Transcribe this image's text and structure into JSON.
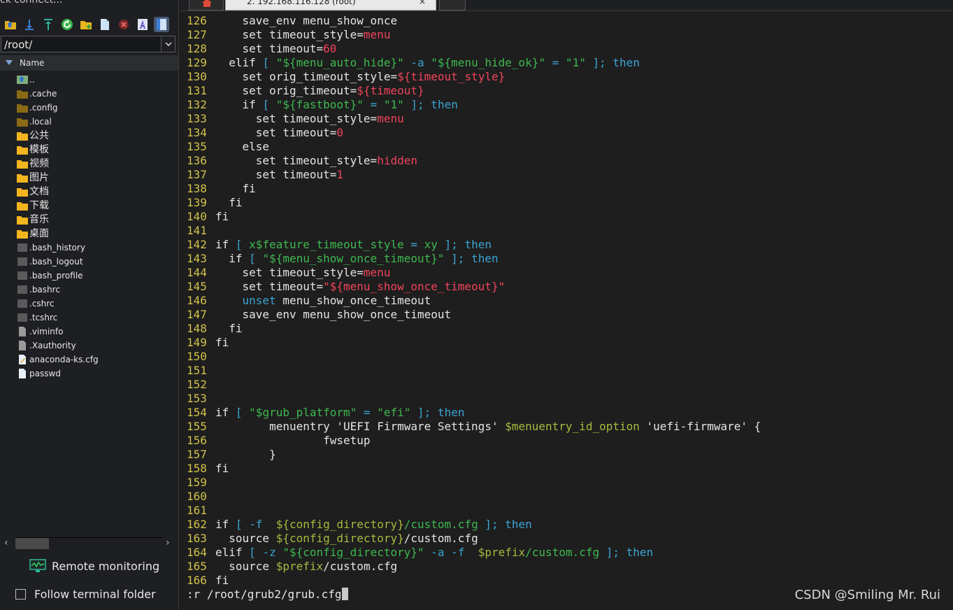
{
  "left_panel": {
    "quick_connect_text": "ck connect...",
    "path": "/root/",
    "column_header": "Name",
    "files": [
      {
        "name": "..",
        "type": "parent"
      },
      {
        "name": ".cache",
        "type": "folder-dark"
      },
      {
        "name": ".config",
        "type": "folder-dark"
      },
      {
        "name": ".local",
        "type": "folder-dark"
      },
      {
        "name": "公共",
        "type": "folder"
      },
      {
        "name": "模板",
        "type": "folder"
      },
      {
        "name": "视频",
        "type": "folder"
      },
      {
        "name": "图片",
        "type": "folder"
      },
      {
        "name": "文档",
        "type": "folder"
      },
      {
        "name": "下载",
        "type": "folder"
      },
      {
        "name": "音乐",
        "type": "folder"
      },
      {
        "name": "桌面",
        "type": "folder"
      },
      {
        "name": ".bash_history",
        "type": "file-dark"
      },
      {
        "name": ".bash_logout",
        "type": "file-dark"
      },
      {
        "name": ".bash_profile",
        "type": "file-dark"
      },
      {
        "name": ".bashrc",
        "type": "file-dark"
      },
      {
        "name": ".cshrc",
        "type": "file-dark"
      },
      {
        "name": ".tcshrc",
        "type": "file-dark"
      },
      {
        "name": ".viminfo",
        "type": "file-gray"
      },
      {
        "name": ".Xauthority",
        "type": "file-gray"
      },
      {
        "name": "anaconda-ks.cfg",
        "type": "file-cfg"
      },
      {
        "name": "passwd",
        "type": "file-white"
      }
    ],
    "remote_monitoring": "Remote monitoring",
    "follow_terminal_folder": "Follow terminal folder"
  },
  "tabs": {
    "session_title": "2. 192.168.116.128 (root)",
    "close_glyph": "×"
  },
  "terminal": {
    "lines": [
      {
        "n": "126",
        "t": [
          [
            "d",
            "    save_env menu_show_once"
          ]
        ]
      },
      {
        "n": "127",
        "t": [
          [
            "d",
            "    set timeout_style="
          ],
          [
            "v",
            "menu"
          ]
        ]
      },
      {
        "n": "128",
        "t": [
          [
            "d",
            "    set timeout="
          ],
          [
            "n",
            "60"
          ]
        ]
      },
      {
        "n": "129",
        "t": [
          [
            "d",
            "  elif "
          ],
          [
            "k",
            "[ "
          ],
          [
            "s",
            "\"${menu_auto_hide}\""
          ],
          [
            "d",
            " "
          ],
          [
            "k",
            "-a"
          ],
          [
            "d",
            " "
          ],
          [
            "s",
            "\"${menu_hide_ok}\""
          ],
          [
            "d",
            " "
          ],
          [
            "k",
            "="
          ],
          [
            "d",
            " "
          ],
          [
            "s",
            "\"1\""
          ],
          [
            "d",
            " "
          ],
          [
            "k",
            "]; then"
          ]
        ]
      },
      {
        "n": "130",
        "t": [
          [
            "d",
            "    set orig_timeout_style="
          ],
          [
            "v",
            "${timeout_style}"
          ]
        ]
      },
      {
        "n": "131",
        "t": [
          [
            "d",
            "    set orig_timeout="
          ],
          [
            "v",
            "${timeout}"
          ]
        ]
      },
      {
        "n": "132",
        "t": [
          [
            "d",
            "    if "
          ],
          [
            "k",
            "[ "
          ],
          [
            "s",
            "\"${fastboot}\""
          ],
          [
            "d",
            " "
          ],
          [
            "k",
            "="
          ],
          [
            "d",
            " "
          ],
          [
            "s",
            "\"1\""
          ],
          [
            "d",
            " "
          ],
          [
            "k",
            "]; then"
          ]
        ]
      },
      {
        "n": "133",
        "t": [
          [
            "d",
            "      set timeout_style="
          ],
          [
            "v",
            "menu"
          ]
        ]
      },
      {
        "n": "134",
        "t": [
          [
            "d",
            "      set timeout="
          ],
          [
            "n",
            "0"
          ]
        ]
      },
      {
        "n": "135",
        "t": [
          [
            "d",
            "    else"
          ]
        ]
      },
      {
        "n": "136",
        "t": [
          [
            "d",
            "      set timeout_style="
          ],
          [
            "v",
            "hidden"
          ]
        ]
      },
      {
        "n": "137",
        "t": [
          [
            "d",
            "      set timeout="
          ],
          [
            "n",
            "1"
          ]
        ]
      },
      {
        "n": "138",
        "t": [
          [
            "d",
            "    fi"
          ]
        ]
      },
      {
        "n": "139",
        "t": [
          [
            "d",
            "  fi"
          ]
        ]
      },
      {
        "n": "140",
        "t": [
          [
            "d",
            "fi"
          ]
        ]
      },
      {
        "n": "141",
        "t": []
      },
      {
        "n": "142",
        "t": [
          [
            "d",
            "if "
          ],
          [
            "k",
            "[ "
          ],
          [
            "s",
            "x$feature_timeout_style"
          ],
          [
            "d",
            " "
          ],
          [
            "k",
            "="
          ],
          [
            "d",
            " "
          ],
          [
            "s",
            "xy"
          ],
          [
            "d",
            " "
          ],
          [
            "k",
            "]; then"
          ]
        ]
      },
      {
        "n": "143",
        "t": [
          [
            "d",
            "  if "
          ],
          [
            "k",
            "[ "
          ],
          [
            "s",
            "\"${menu_show_once_timeout}\""
          ],
          [
            "d",
            " "
          ],
          [
            "k",
            "]; then"
          ]
        ]
      },
      {
        "n": "144",
        "t": [
          [
            "d",
            "    set timeout_style="
          ],
          [
            "v",
            "menu"
          ]
        ]
      },
      {
        "n": "145",
        "t": [
          [
            "d",
            "    set timeout="
          ],
          [
            "v",
            "\"${menu_show_once_timeout}\""
          ]
        ]
      },
      {
        "n": "146",
        "t": [
          [
            "d",
            "    "
          ],
          [
            "k",
            "unset"
          ],
          [
            "d",
            " menu_show_once_timeout"
          ]
        ]
      },
      {
        "n": "147",
        "t": [
          [
            "d",
            "    save_env menu_show_once_timeout"
          ]
        ]
      },
      {
        "n": "148",
        "t": [
          [
            "d",
            "  fi"
          ]
        ]
      },
      {
        "n": "149",
        "t": [
          [
            "d",
            "fi"
          ]
        ]
      },
      {
        "n": "150",
        "t": []
      },
      {
        "n": "151",
        "t": []
      },
      {
        "n": "152",
        "t": []
      },
      {
        "n": "153",
        "t": []
      },
      {
        "n": "154",
        "t": [
          [
            "d",
            "if "
          ],
          [
            "k",
            "[ "
          ],
          [
            "s",
            "\"$grub_platform\""
          ],
          [
            "d",
            " "
          ],
          [
            "k",
            "="
          ],
          [
            "d",
            " "
          ],
          [
            "s",
            "\"efi\""
          ],
          [
            "d",
            " "
          ],
          [
            "k",
            "]; then"
          ]
        ]
      },
      {
        "n": "155",
        "t": [
          [
            "d",
            "        menuentry 'UEFI Firmware Settings' "
          ],
          [
            "g",
            "$menuentry_id_option"
          ],
          [
            "d",
            " 'uefi-firmware' {"
          ]
        ]
      },
      {
        "n": "156",
        "t": [
          [
            "d",
            "                fwsetup"
          ]
        ]
      },
      {
        "n": "157",
        "t": [
          [
            "d",
            "        }"
          ]
        ]
      },
      {
        "n": "158",
        "t": [
          [
            "d",
            "fi"
          ]
        ]
      },
      {
        "n": "159",
        "t": []
      },
      {
        "n": "160",
        "t": []
      },
      {
        "n": "161",
        "t": []
      },
      {
        "n": "162",
        "t": [
          [
            "d",
            "if "
          ],
          [
            "k",
            "[ -f"
          ],
          [
            "d",
            "  "
          ],
          [
            "g",
            "${config_directory}"
          ],
          [
            "s",
            "/custom.cfg"
          ],
          [
            "d",
            " "
          ],
          [
            "k",
            "]; then"
          ]
        ]
      },
      {
        "n": "163",
        "t": [
          [
            "d",
            "  source "
          ],
          [
            "g",
            "${config_directory}"
          ],
          [
            "d",
            "/custom.cfg"
          ]
        ]
      },
      {
        "n": "164",
        "t": [
          [
            "d",
            "elif "
          ],
          [
            "k",
            "[ -z"
          ],
          [
            "d",
            " "
          ],
          [
            "s",
            "\"${config_directory}\""
          ],
          [
            "d",
            " "
          ],
          [
            "k",
            "-a -f"
          ],
          [
            "d",
            "  "
          ],
          [
            "g",
            "$prefix"
          ],
          [
            "s",
            "/custom.cfg"
          ],
          [
            "d",
            " "
          ],
          [
            "k",
            "]; then"
          ]
        ]
      },
      {
        "n": "165",
        "t": [
          [
            "d",
            "  source "
          ],
          [
            "g",
            "$prefix"
          ],
          [
            "d",
            "/custom.cfg"
          ]
        ]
      },
      {
        "n": "166",
        "t": [
          [
            "d",
            "fi"
          ]
        ]
      }
    ],
    "command_line": ":r /root/grub2/grub.cfg",
    "watermark": "CSDN @Smiling Mr. Rui"
  }
}
